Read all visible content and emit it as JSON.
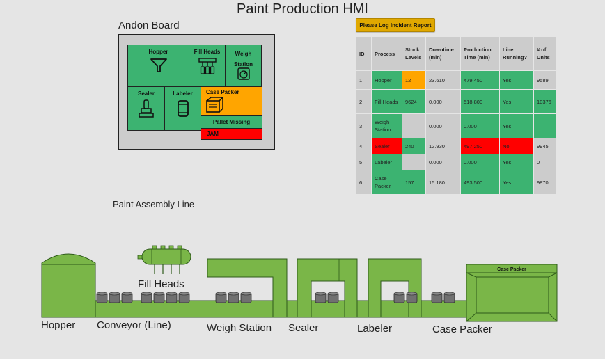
{
  "title": "Paint Production HMI",
  "andon": {
    "title": "Andon Board",
    "hopper": "Hopper",
    "fill_heads": "Fill Heads",
    "weigh_station": "Weigh Station",
    "sealer": "Sealer",
    "labeler": "Labeler",
    "case_packer": "Case Packer",
    "pallet_missing": "Pallet Missing",
    "jam": "JAM"
  },
  "log_button": "Please Log Incident Report",
  "table": {
    "headers": [
      "ID",
      "Process",
      "Stock Levels",
      "Downtime (min)",
      "Production Time (min)",
      "Line Running?",
      "# of Units"
    ],
    "rows": [
      [
        "1",
        "Hopper",
        "12",
        "23.610",
        "479.450",
        "Yes",
        "9589"
      ],
      [
        "2",
        "Fill Heads",
        "9624",
        "0.000",
        "518.800",
        "Yes",
        "10376"
      ],
      [
        "3",
        "Weigh Station",
        "",
        "0.000",
        "0.000",
        "Yes",
        ""
      ],
      [
        "4",
        "Sealer",
        "240",
        "12.930",
        "497.250",
        "No",
        "9945"
      ],
      [
        "5",
        "Labeler",
        "",
        "0.000",
        "0.000",
        "Yes",
        "0"
      ],
      [
        "6",
        "Case Packer",
        "157",
        "15.180",
        "493.500",
        "Yes",
        "9870"
      ]
    ],
    "cell_colors": [
      [
        "gray",
        "green",
        "amber",
        "gray",
        "green",
        "green",
        "gray"
      ],
      [
        "gray",
        "green",
        "green",
        "gray",
        "green",
        "green",
        "green"
      ],
      [
        "gray",
        "green",
        "gray",
        "gray",
        "green",
        "green",
        "green"
      ],
      [
        "gray",
        "red",
        "green",
        "gray",
        "red",
        "red",
        "gray"
      ],
      [
        "gray",
        "green",
        "gray",
        "gray",
        "green",
        "green",
        "gray"
      ],
      [
        "gray",
        "green",
        "green",
        "gray",
        "green",
        "green",
        "gray"
      ]
    ]
  },
  "line": {
    "title": "Paint Assembly Line",
    "labels": {
      "fill_heads": "Fill Heads",
      "hopper": "Hopper",
      "conveyor": "Conveyor (Line)",
      "weigh_station": "Weigh Station",
      "sealer": "Sealer",
      "labeler": "Labeler",
      "case_packer": "Case Packer",
      "case_packer_box": "Case Packer"
    }
  },
  "colors": {
    "andon_green": "#3cb371",
    "andon_amber": "#ffa500",
    "andon_red": "#ff0000",
    "machine_green": "#7ab648",
    "button": "#e0a800"
  }
}
